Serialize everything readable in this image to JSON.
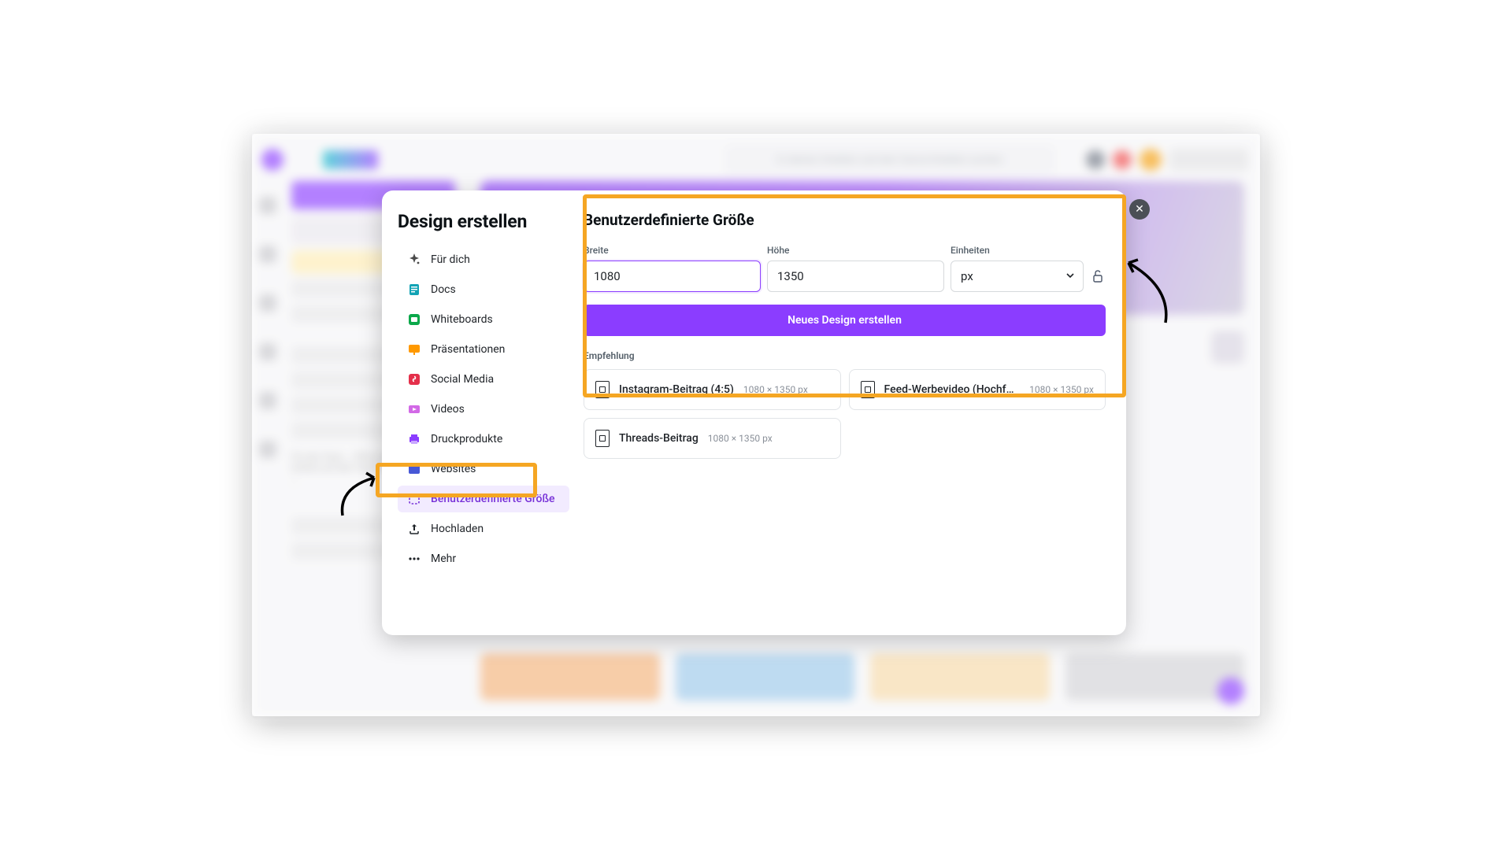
{
  "modal": {
    "title": "Design erstellen",
    "nav": [
      {
        "label": "Für dich"
      },
      {
        "label": "Docs"
      },
      {
        "label": "Whiteboards"
      },
      {
        "label": "Präsentationen"
      },
      {
        "label": "Social Media"
      },
      {
        "label": "Videos"
      },
      {
        "label": "Druckprodukte"
      },
      {
        "label": "Websites"
      },
      {
        "label": "Benutzerdefinierte Größe"
      },
      {
        "label": "Hochladen"
      },
      {
        "label": "Mehr"
      }
    ],
    "right": {
      "heading": "Benutzerdefinierte Größe",
      "width_label": "Breite",
      "height_label": "Höhe",
      "units_label": "Einheiten",
      "width_value": "1080",
      "height_value": "1350",
      "units_value": "px",
      "create_button": "Neues Design erstellen",
      "recommend_label": "Empfehlung",
      "recs": [
        {
          "title": "Instagram-Beitrag (4:5)",
          "dim": "1080 × 1350 px"
        },
        {
          "title": "Feed-Werbevideo (Hochform…",
          "dim": "1080 × 1350 px"
        },
        {
          "title": "Threads-Beitrag",
          "dim": "1080 × 1350 px"
        }
      ]
    }
  },
  "bg": {
    "search_placeholder": "In deinen Inhalten und den Canva-Inhalten suchen"
  },
  "colors": {
    "accent": "#8b3dff",
    "highlight": "#f5a623"
  }
}
